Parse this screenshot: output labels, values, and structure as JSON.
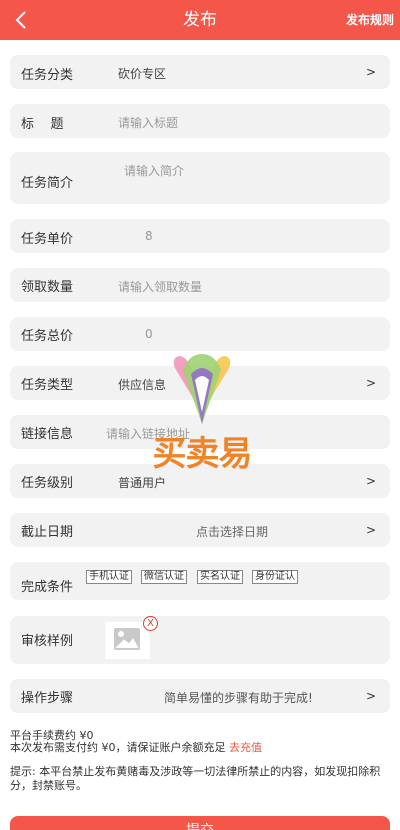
{
  "header": {
    "title": "发布",
    "rules_link": "发布规则",
    "back_icon": "chevron-left-icon",
    "color": "#f4564a"
  },
  "form": {
    "category": {
      "label": "任务分类",
      "value": "砍价专区",
      "chevron": ">"
    },
    "title": {
      "label": "标    题",
      "placeholder": "请输入标题"
    },
    "intro": {
      "label": "任务简介",
      "placeholder": "请输入简介"
    },
    "unit_price": {
      "label": "任务单价",
      "value": "8"
    },
    "quantity": {
      "label": "领取数量",
      "placeholder": "请输入领取数量"
    },
    "total_price": {
      "label": "任务总价",
      "value": "0"
    },
    "task_type": {
      "label": "任务类型",
      "value": "供应信息",
      "chevron": ">"
    },
    "link": {
      "label": "链接信息",
      "placeholder": "请输入链接地址"
    },
    "level": {
      "label": "任务级别",
      "value": "普通用户",
      "chevron": ">"
    },
    "deadline": {
      "label": "截止日期",
      "placeholder": "点击选择日期",
      "chevron": ">"
    },
    "conditions": {
      "label": "完成条件",
      "tags": [
        "手机认证",
        "微信认证",
        "实名认证",
        "身份证认"
      ]
    },
    "sample": {
      "label": "审核样例",
      "remove_symbol": "X",
      "image_icon": "image-placeholder-icon"
    },
    "steps": {
      "label": "操作步骤",
      "value": "简单易懂的步骤有助于完成!",
      "chevron": ">"
    }
  },
  "fees": {
    "platform_fee": "平台手续费约 ¥0",
    "payment": "本次发布需支付约 ¥0，请保证账户余额充足",
    "recharge_link": "去充值",
    "notice": "提示: 本平台禁止发布黄赌毒及涉政等一切法律所禁止的内容，如发现扣除积分，封禁账号。"
  },
  "watermark": {
    "text": "买卖易"
  },
  "submit": {
    "label": "提交"
  }
}
